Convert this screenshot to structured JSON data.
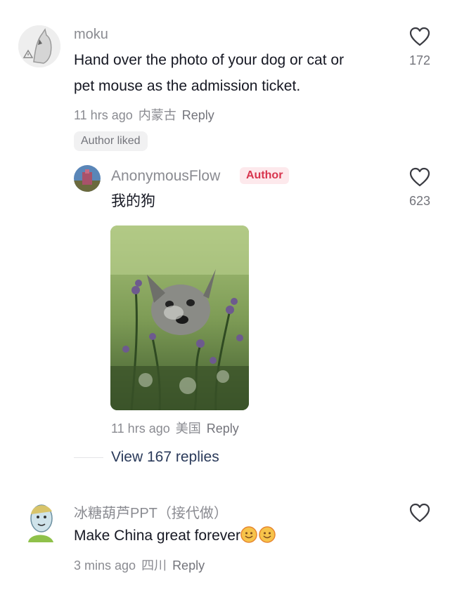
{
  "comments": [
    {
      "username": "moku",
      "text_line1": "Hand over the photo of your dog or cat or",
      "text_line2": "pet mouse as the admission ticket.",
      "time": "11 hrs ago",
      "location": "内蒙古",
      "reply_label": "Reply",
      "likes": "172",
      "author_liked_label": "Author liked"
    },
    {
      "username": "AnonymousFlow",
      "badge": "Author",
      "text": "我的狗",
      "time": "11 hrs ago",
      "location": "美国",
      "reply_label": "Reply",
      "likes": "623",
      "image_icon": "dog-photo"
    },
    {
      "username": "冰糖葫芦PPT（接代做）",
      "text": "Make China great forever",
      "emoji": [
        "smiling-face-emoji",
        "smiling-face-emoji"
      ],
      "time": "3 mins ago",
      "location": "四川",
      "reply_label": "Reply"
    }
  ],
  "view_replies_label": "View 167 replies",
  "colors": {
    "text": "#161823",
    "muted": "#8a8b91",
    "author_badge_bg": "#fde9ec",
    "author_badge_fg": "#d8354e"
  }
}
